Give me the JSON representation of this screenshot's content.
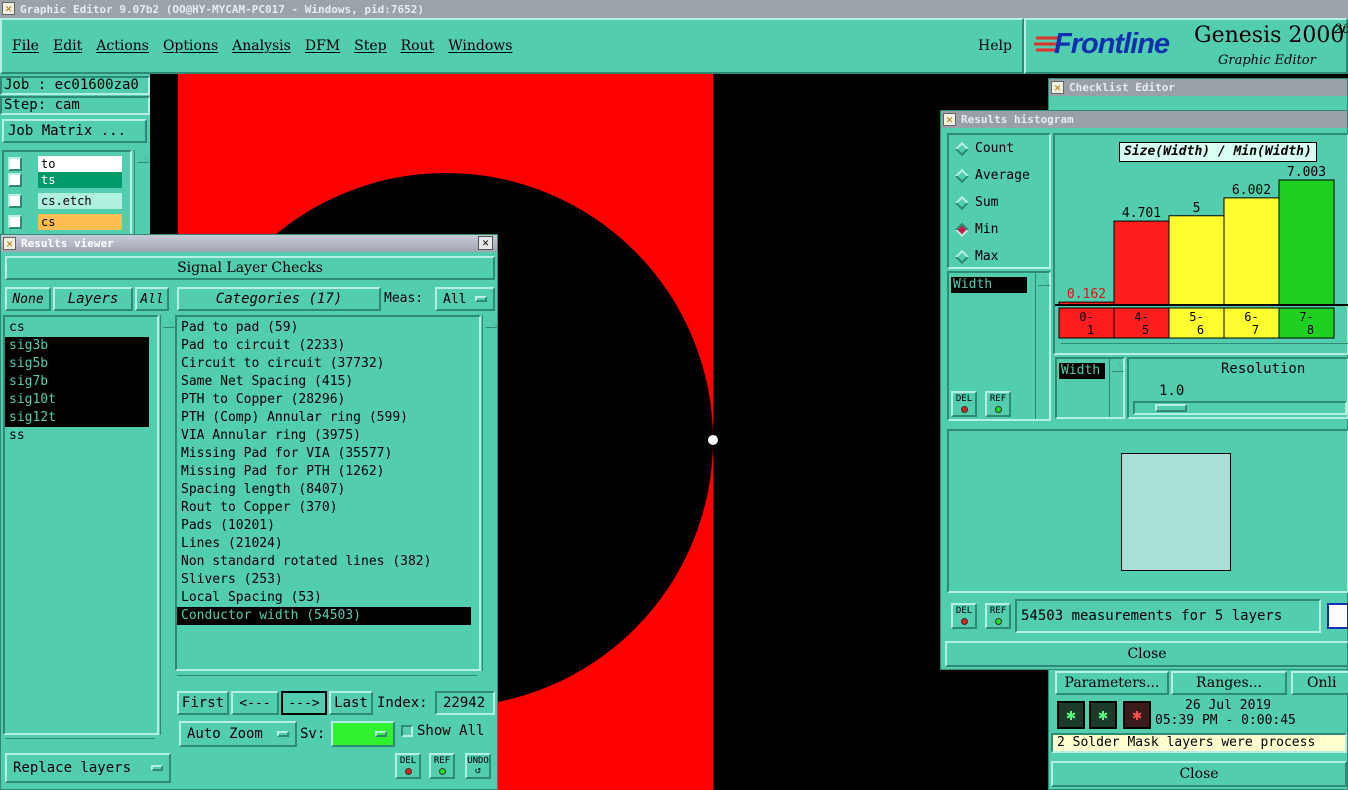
{
  "window_title": "Graphic Editor 9.07b2 (OO@HY-MYCAM-PC017 - Windows, pid:7652)",
  "menu": [
    "File",
    "Edit",
    "Actions",
    "Options",
    "Analysis",
    "DFM",
    "Step",
    "Rout",
    "Windows"
  ],
  "help_label": "Help",
  "brand": {
    "logo": "Frontline",
    "product": "Genesis 2000",
    "version_sup": "26",
    "subtitle": "Graphic Editor"
  },
  "job": {
    "job_label": "Job : ec01600za0",
    "step_label": "Step: cam",
    "matrix_button": "Job Matrix ..."
  },
  "layer_rows": [
    {
      "name": "to",
      "color": "#ffffff"
    },
    {
      "name": "ts",
      "color": "#009a6a"
    },
    {
      "name": "cs.etch",
      "color": "#b0f0e0"
    },
    {
      "name": "cs",
      "color": "#ffbf50"
    }
  ],
  "results_viewer": {
    "title": "Results viewer",
    "header": "Signal Layer Checks",
    "none_btn": "None",
    "layers_btn": "Layers",
    "all_btn": "All",
    "layers": [
      {
        "name": "cs",
        "selected": false
      },
      {
        "name": "sig3b",
        "selected": true
      },
      {
        "name": "sig5b",
        "selected": true
      },
      {
        "name": "sig7b",
        "selected": true
      },
      {
        "name": "sig10t",
        "selected": true
      },
      {
        "name": "sig12t",
        "selected": true
      },
      {
        "name": "ss",
        "selected": false
      }
    ],
    "categories_btn": "Categories (17)",
    "meas_label": "Meas:",
    "meas_value": "All",
    "categories": [
      {
        "text": "Pad to pad (59)",
        "selected": false
      },
      {
        "text": "Pad to circuit (2233)",
        "selected": false
      },
      {
        "text": "Circuit to circuit (37732)",
        "selected": false
      },
      {
        "text": "Same Net Spacing (415)",
        "selected": false
      },
      {
        "text": "PTH to Copper (28296)",
        "selected": false
      },
      {
        "text": "PTH (Comp) Annular ring (599)",
        "selected": false
      },
      {
        "text": "VIA Annular ring (3975)",
        "selected": false
      },
      {
        "text": "Missing Pad for VIA (35577)",
        "selected": false
      },
      {
        "text": "Missing Pad for PTH (1262)",
        "selected": false
      },
      {
        "text": "Spacing length (8407)",
        "selected": false
      },
      {
        "text": "Rout to Copper (370)",
        "selected": false
      },
      {
        "text": "Pads (10201)",
        "selected": false
      },
      {
        "text": "Lines (21024)",
        "selected": false
      },
      {
        "text": "Non standard rotated lines (382)",
        "selected": false
      },
      {
        "text": "Slivers (253)",
        "selected": false
      },
      {
        "text": "Local Spacing (53)",
        "selected": false
      },
      {
        "text": "Conductor width (54503)",
        "selected": true
      }
    ],
    "first_btn": "First",
    "prev_btn": "<---",
    "next_btn": "--->",
    "last_btn": "Last",
    "index_label": "Index:",
    "index_value": "22942",
    "autozoom_label": "Auto Zoom",
    "sv_label": "Sv:",
    "show_all_label": "Show All",
    "replace_layers_label": "Replace layers",
    "del_label": "DEL",
    "ref_label": "REF",
    "undo_label": "UNDO"
  },
  "histogram": {
    "title": "Results histogram",
    "modes": [
      {
        "label": "Count",
        "selected": false
      },
      {
        "label": "Average",
        "selected": false
      },
      {
        "label": "Sum",
        "selected": false
      },
      {
        "label": "Min",
        "selected": true
      },
      {
        "label": "Max",
        "selected": false
      }
    ],
    "chart_title": "Size(Width) / Min(Width)",
    "width_list_label": "Width",
    "width_field": "Width",
    "resolution_label": "Resolution",
    "resolution_value": "1.0",
    "summary": "54503 measurements for 5 layers",
    "close_label": "Close",
    "del_label": "DEL",
    "ref_label": "REF"
  },
  "chart_data": {
    "type": "bar",
    "title": "Size(Width) / Min(Width)",
    "categories": [
      "0-1",
      "4-5",
      "5-6",
      "6-7",
      "7-8"
    ],
    "values": [
      0.162,
      4.701,
      5,
      6.002,
      7.003
    ],
    "value_labels": [
      "0.162",
      "4.701",
      "5",
      "6.002",
      "7.003"
    ],
    "colors": [
      "#ff1e1e",
      "#ff1e1e",
      "#ffff30",
      "#ffff30",
      "#20d020"
    ]
  },
  "checklist": {
    "title": "Checklist Editor",
    "parameters_btn": "Parameters...",
    "ranges_btn": "Ranges...",
    "online_btn": "Onli",
    "date": "26 Jul 2019",
    "time": "05:39 PM - 0:00:45",
    "status": "2 Solder Mask layers were process",
    "close_label": "Close"
  }
}
